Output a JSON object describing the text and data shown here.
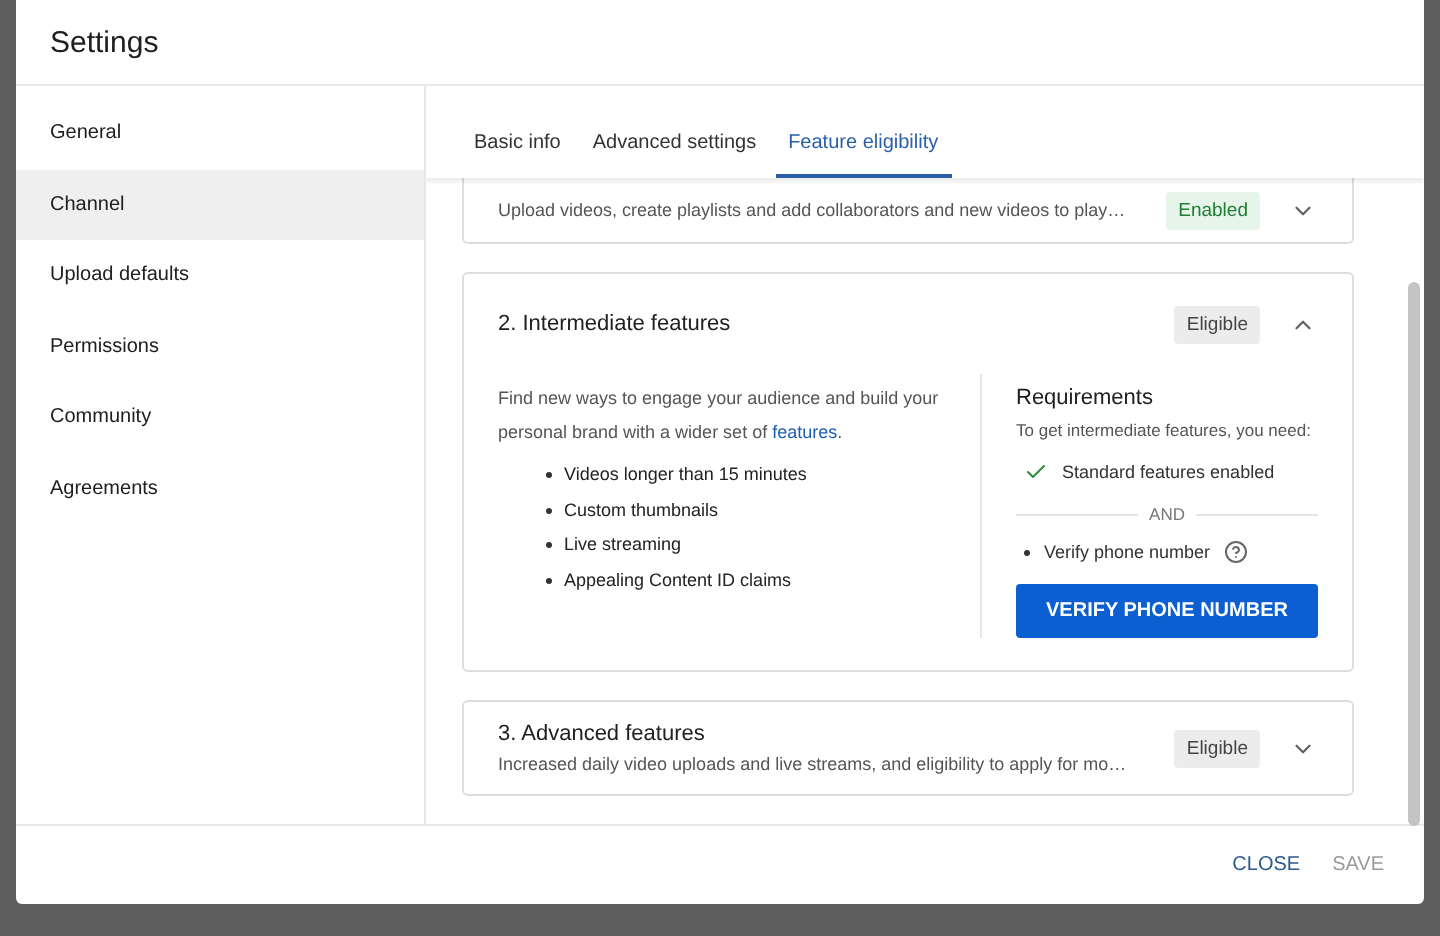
{
  "dialog": {
    "title": "Settings"
  },
  "sidebar": {
    "items": [
      {
        "label": "General",
        "selected": false
      },
      {
        "label": "Channel",
        "selected": true
      },
      {
        "label": "Upload defaults",
        "selected": false
      },
      {
        "label": "Permissions",
        "selected": false
      },
      {
        "label": "Community",
        "selected": false
      },
      {
        "label": "Agreements",
        "selected": false
      }
    ]
  },
  "tabs": [
    {
      "label": "Basic info",
      "selected": false
    },
    {
      "label": "Advanced settings",
      "selected": false
    },
    {
      "label": "Feature eligibility",
      "selected": true
    }
  ],
  "cards": [
    {
      "description": "Upload videos, create playlists and add collaborators and new videos to play…",
      "badge": {
        "text": "Enabled",
        "kind": "enabled"
      },
      "expanded": false
    },
    {
      "title": "2. Intermediate features",
      "badge": {
        "text": "Eligible",
        "kind": "eligible"
      },
      "expanded": true,
      "details": {
        "intro": {
          "text": "Find new ways to engage your audience and build your personal brand with a wider set of ",
          "link": "features",
          "after": "."
        },
        "features": [
          "Videos longer than 15 minutes",
          "Custom thumbnails",
          "Live streaming",
          "Appealing Content ID claims"
        ],
        "requirements": {
          "heading": "Requirements",
          "intro": "To get intermediate features, you need:",
          "items": [
            {
              "text": "Standard features enabled",
              "met": true
            },
            {
              "text": "Verify phone number",
              "met": false
            }
          ],
          "separator": "AND",
          "button": "VERIFY PHONE NUMBER"
        }
      }
    },
    {
      "title": "3. Advanced features",
      "description": "Increased daily video uploads and live streams, and eligibility to apply for mo…",
      "badge": {
        "text": "Eligible",
        "kind": "eligible"
      },
      "expanded": false
    }
  ],
  "footer": {
    "buttons": [
      {
        "label": "CLOSE",
        "disabled": false
      },
      {
        "label": "SAVE",
        "disabled": true
      }
    ]
  }
}
